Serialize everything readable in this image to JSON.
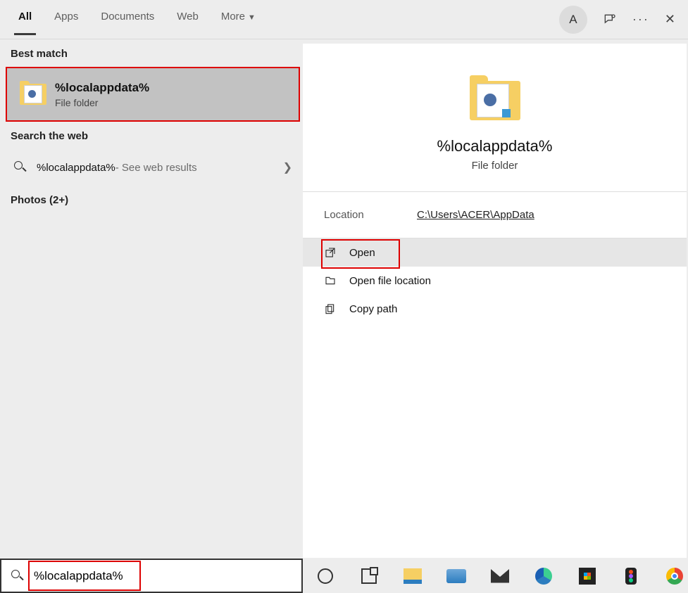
{
  "tabs": {
    "all": "All",
    "apps": "Apps",
    "documents": "Documents",
    "web": "Web",
    "more": "More"
  },
  "avatar_initial": "A",
  "sections": {
    "best_match": "Best match",
    "search_web": "Search the web",
    "photos": "Photos (2+)"
  },
  "best_match": {
    "title": "%localappdata%",
    "subtitle": "File folder"
  },
  "web_search": {
    "query": "%localappdata%",
    "suffix": " - See web results"
  },
  "preview": {
    "title": "%localappdata%",
    "subtitle": "File folder",
    "location_label": "Location",
    "location_value": "C:\\Users\\ACER\\AppData"
  },
  "actions": {
    "open": "Open",
    "open_loc": "Open file location",
    "copy_path": "Copy path"
  },
  "searchbox": {
    "value": "%localappdata%"
  }
}
